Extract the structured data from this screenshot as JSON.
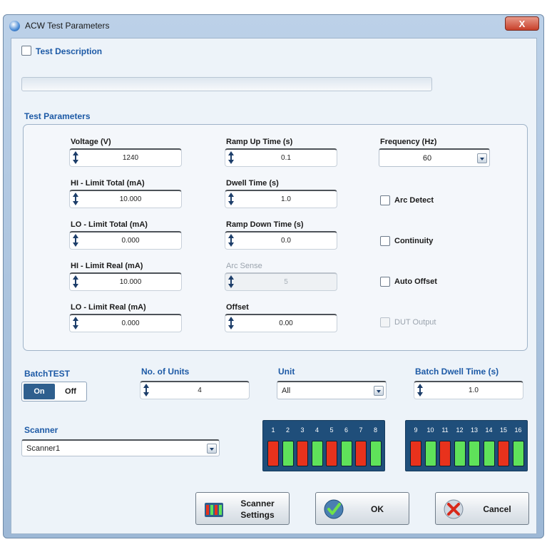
{
  "window": {
    "title": "ACW Test Parameters",
    "close": "X"
  },
  "description": {
    "label": "Test Description",
    "value": ""
  },
  "params": {
    "title": "Test Parameters",
    "voltage": {
      "label": "Voltage (V)",
      "value": "1240"
    },
    "hi_total": {
      "label": "HI - Limit Total (mA)",
      "value": "10.000"
    },
    "lo_total": {
      "label": "LO - Limit Total (mA)",
      "value": "0.000"
    },
    "hi_real": {
      "label": "HI - Limit Real (mA)",
      "value": "10.000"
    },
    "lo_real": {
      "label": "LO - Limit Real (mA)",
      "value": "0.000"
    },
    "ramp_up": {
      "label": "Ramp Up Time (s)",
      "value": "0.1"
    },
    "dwell": {
      "label": "Dwell Time (s)",
      "value": "1.0"
    },
    "ramp_down": {
      "label": "Ramp Down Time (s)",
      "value": "0.0"
    },
    "arc_sense": {
      "label": "Arc Sense",
      "value": "5"
    },
    "offset": {
      "label": "Offset",
      "value": "0.00"
    },
    "frequency": {
      "label": "Frequency (Hz)",
      "value": "60"
    },
    "arc_detect": "Arc Detect",
    "continuity": "Continuity",
    "auto_offset": "Auto Offset",
    "dut_output": "DUT Output"
  },
  "batch": {
    "label": "BatchTEST",
    "on": "On",
    "off": "Off",
    "units_label": "No. of Units",
    "units_value": "4",
    "unit_label": "Unit",
    "unit_value": "All",
    "dwell_label": "Batch Dwell Time (s)",
    "dwell_value": "1.0"
  },
  "scanner": {
    "label": "Scanner",
    "value": "Scanner1"
  },
  "channels": {
    "group1": [
      {
        "n": "1",
        "state": "fail"
      },
      {
        "n": "2",
        "state": "pass"
      },
      {
        "n": "3",
        "state": "fail"
      },
      {
        "n": "4",
        "state": "pass"
      },
      {
        "n": "5",
        "state": "fail"
      },
      {
        "n": "6",
        "state": "pass"
      },
      {
        "n": "7",
        "state": "fail"
      },
      {
        "n": "8",
        "state": "pass"
      }
    ],
    "group2": [
      {
        "n": "9",
        "state": "fail"
      },
      {
        "n": "10",
        "state": "pass"
      },
      {
        "n": "11",
        "state": "fail"
      },
      {
        "n": "12",
        "state": "pass"
      },
      {
        "n": "13",
        "state": "pass"
      },
      {
        "n": "14",
        "state": "pass"
      },
      {
        "n": "15",
        "state": "fail"
      },
      {
        "n": "16",
        "state": "pass"
      }
    ],
    "colors": {
      "fail": "#e8321c",
      "pass": "#5fe25a"
    }
  },
  "buttons": {
    "scanner_settings": {
      "line1": "Scanner",
      "line2": "Settings"
    },
    "ok": "OK",
    "cancel": "Cancel"
  }
}
